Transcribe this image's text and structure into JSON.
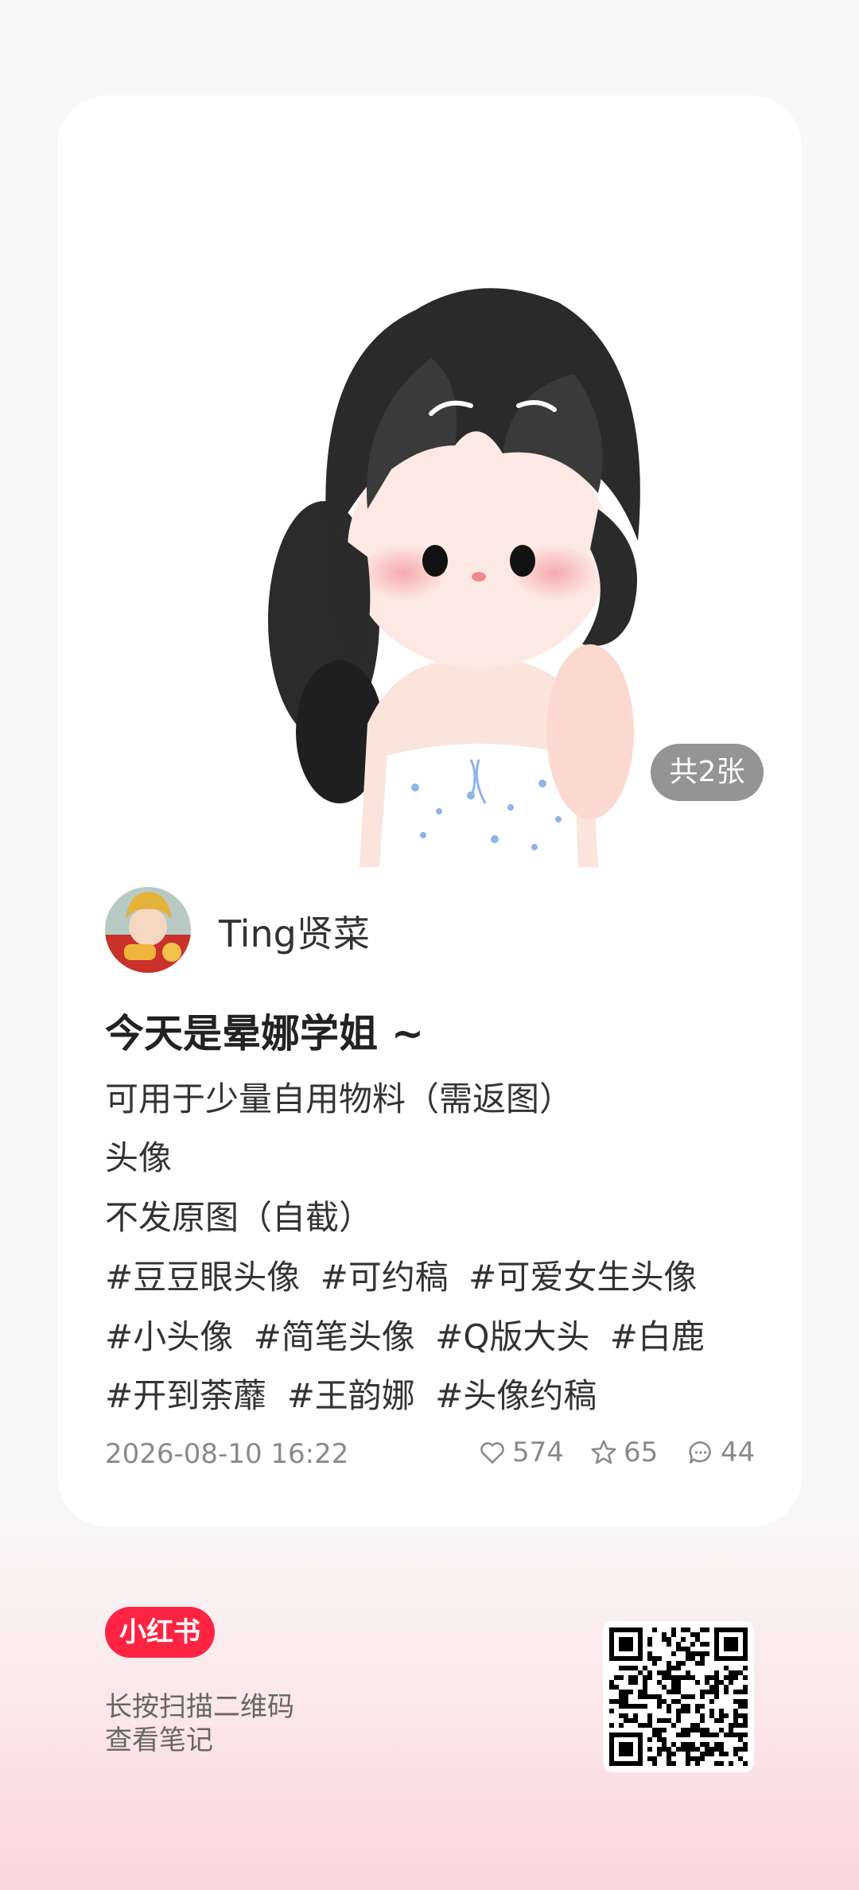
{
  "note": {
    "image_count": "共2张",
    "author": "Ting贤菜",
    "title": "今天是晕娜学姐 ~",
    "body_lines": [
      "可用于少量自用物料（需返图）",
      "头像",
      "不发原图（自截）"
    ],
    "tag_lines": [
      [
        "#豆豆眼头像",
        "#可约稿",
        "#可爱女生头像"
      ],
      [
        "#小头像",
        "#简笔头像",
        "#Q版大头",
        "#白鹿"
      ],
      [
        "#开到荼蘼",
        "#王韵娜",
        "#头像约稿"
      ]
    ],
    "date": "2026-08-10 16:22",
    "stats": {
      "likes": "574",
      "collects": "65",
      "comments": "44"
    }
  },
  "footer": {
    "brand": "小红书",
    "scan_line1": "长按扫描二维码",
    "scan_line2": "查看笔记"
  },
  "colors": {
    "brand": "#ff2442",
    "badge_bg": "#6b6b6b",
    "meta_text": "#8a8a8a"
  },
  "icons": [
    "heart-icon",
    "star-icon",
    "comment-icon",
    "qr-code"
  ]
}
